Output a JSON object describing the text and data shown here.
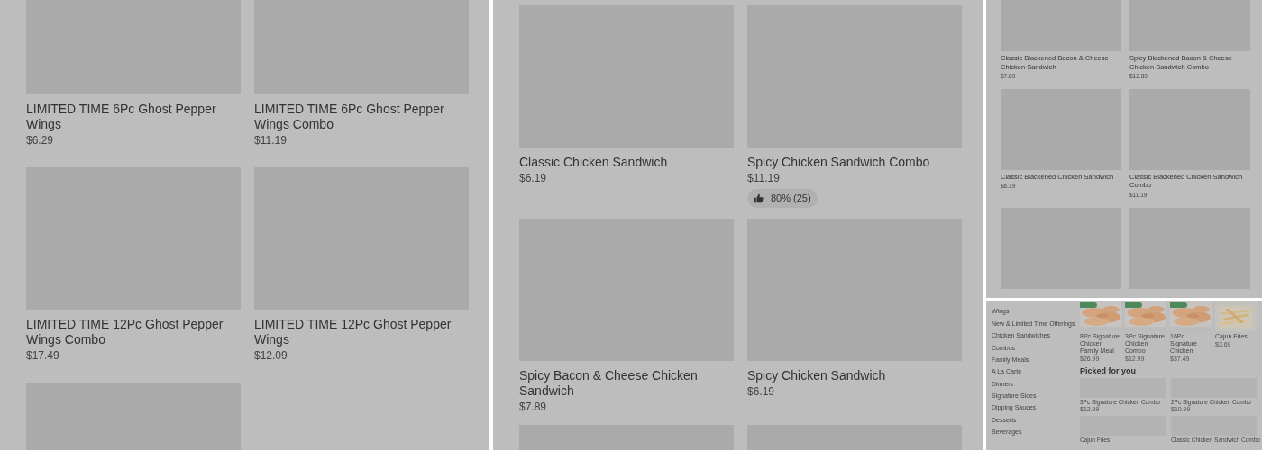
{
  "panels": [
    {
      "kind": "grid_large",
      "items": [
        {
          "title": "LIMITED TIME 6Pc Ghost Pepper Wings",
          "price": "$6.29"
        },
        {
          "title": "LIMITED TIME 6Pc Ghost Pepper Wings Combo",
          "price": "$11.19"
        },
        {
          "title": "LIMITED TIME 12Pc Ghost Pepper Wings Combo",
          "price": "$17.49"
        },
        {
          "title": "LIMITED TIME 12Pc Ghost Pepper Wings",
          "price": "$12.09"
        },
        {
          "image_only": true
        }
      ]
    },
    {
      "kind": "grid_large",
      "items": [
        {
          "title": "Classic Chicken Sandwich",
          "price": "$6.19"
        },
        {
          "title": "Spicy Chicken Sandwich Combo",
          "price": "$11.19",
          "rating": "80% (25)"
        },
        {
          "title": "Spicy Bacon & Cheese Chicken Sandwich",
          "price": "$7.89"
        },
        {
          "title": "Spicy Chicken Sandwich",
          "price": "$6.19"
        },
        {
          "image_only": true
        },
        {
          "image_only": true
        }
      ]
    },
    {
      "kind": "grid_small",
      "items": [
        {
          "title": "Classic Blackened Bacon & Cheese Chicken Sandwich",
          "price": "$7.89"
        },
        {
          "title": "Spicy Blackened Bacon & Cheese Chicken Sandwich Combo",
          "price": "$12.89"
        },
        {
          "title": "Classic Blackened Chicken Sandwich",
          "price": "$6.19"
        },
        {
          "title": "Classic Blackened Chicken Sandwich Combo",
          "price": "$11.19"
        },
        {
          "image_only": true
        },
        {
          "image_only": true
        }
      ]
    },
    {
      "kind": "menu_page",
      "categories": [
        "Wings",
        "New & Limited Time Offerings",
        "Chicken Sandwiches",
        "Combos",
        "Family Meals",
        "A La Carte",
        "Dinners",
        "Signature Sides",
        "Dipping Sauces",
        "Desserts",
        "Beverages"
      ],
      "featured": [
        {
          "title": "8Pc Signature Chicken Family Meal",
          "price": "$26.99",
          "tagged": true
        },
        {
          "title": "3Pc Signature Chicken Combo",
          "price": "$12.99",
          "tagged": true
        },
        {
          "title": "16Pc Signature Chicken",
          "price": "$37.49",
          "tagged": true
        },
        {
          "title": "Cajun Fries",
          "price": "$3.69",
          "tagged": false
        }
      ],
      "section_title": "Picked for you",
      "picked": [
        {
          "title": "3Pc Signature Chicken Combo",
          "price": "$12.99"
        },
        {
          "title": "2Pc Signature Chicken Combo",
          "price": "$10.99"
        },
        {
          "title": "Cajun Fries"
        },
        {
          "title": "Classic Chicken Sandwich Combo"
        }
      ]
    }
  ]
}
